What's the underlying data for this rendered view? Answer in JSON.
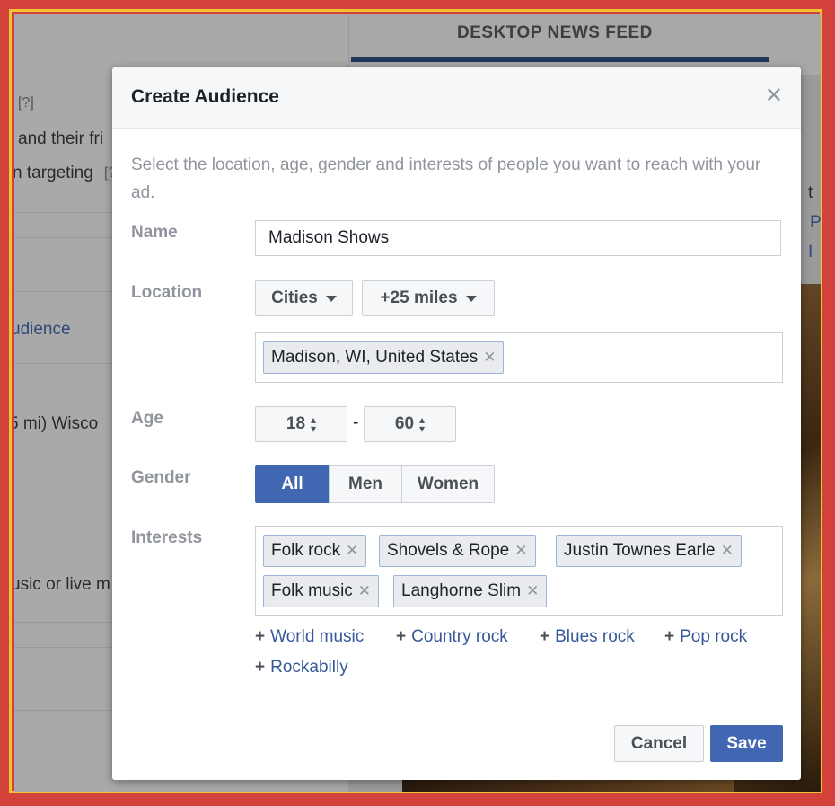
{
  "background": {
    "left_texts": [
      {
        "text": "[?]",
        "kind": "text"
      },
      {
        "text": "and their fri",
        "kind": "text"
      },
      {
        "text": "n targeting",
        "kind": "text"
      },
      {
        "text": "[?",
        "kind": "text"
      },
      {
        "text": "udience",
        "kind": "link"
      },
      {
        "text": "5 mi) Wisco",
        "kind": "text"
      },
      {
        "text": "usic or live m",
        "kind": "text"
      }
    ],
    "tab_label": "DESKTOP NEWS FEED",
    "feed_texts": [
      "t",
      "P",
      "I"
    ]
  },
  "modal": {
    "title": "Create Audience",
    "close_icon": "close-icon",
    "intro": "Select the location, age, gender and interests of people you want to reach with your ad.",
    "name": {
      "label": "Name",
      "value": "Madison Shows"
    },
    "location": {
      "label": "Location",
      "type_button": "Cities",
      "radius_button": "+25 miles",
      "tokens": [
        "Madison, WI, United States"
      ]
    },
    "age": {
      "label": "Age",
      "min": "18",
      "separator": "-",
      "max": "60"
    },
    "gender": {
      "label": "Gender",
      "options": [
        "All",
        "Men",
        "Women"
      ],
      "selected": "All"
    },
    "interests": {
      "label": "Interests",
      "tokens": [
        "Folk rock",
        "Shovels & Rope",
        "Justin Townes Earle",
        "Folk music",
        "Langhorne Slim"
      ],
      "suggestions": [
        "World music",
        "Country rock",
        "Blues rock",
        "Pop rock",
        "Rockabilly"
      ]
    },
    "footer": {
      "cancel": "Cancel",
      "save": "Save"
    }
  },
  "colors": {
    "primary": "#4267b2",
    "link": "#365899",
    "frame_red": "#d2423a",
    "frame_yellow": "#f1c232"
  }
}
